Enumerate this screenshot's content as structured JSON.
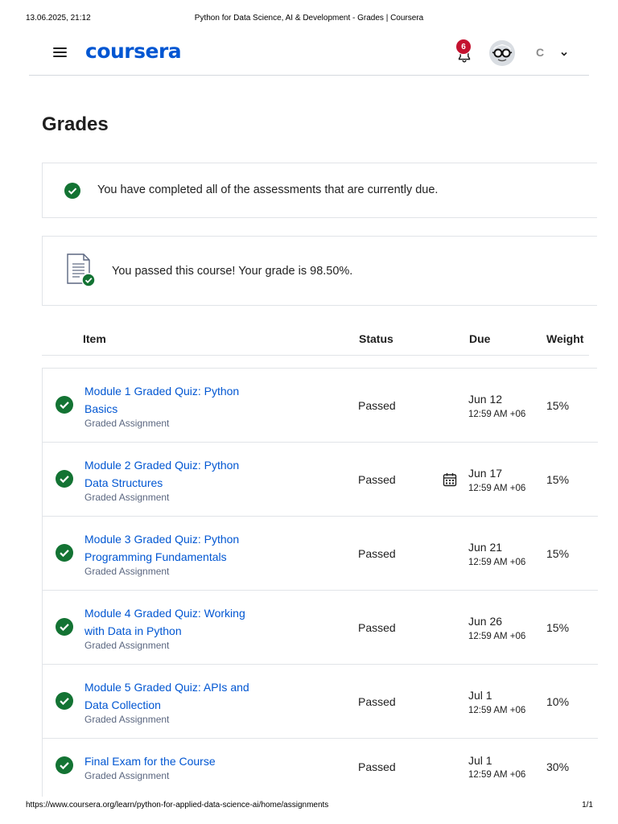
{
  "print": {
    "datetime": "13.06.2025, 21:12",
    "title": "Python for Data Science, AI & Development - Grades | Coursera",
    "url": "https://www.coursera.org/learn/python-for-applied-data-science-ai/home/assignments",
    "page": "1/1"
  },
  "nav": {
    "logo": "coursera",
    "notification_count": "6",
    "user_initial": "C",
    "icons": [
      "menu-icon",
      "bell-icon",
      "avatar",
      "chevron-down-icon"
    ]
  },
  "page_title": "Grades",
  "banners": {
    "completed": "You have completed all of the assessments that are currently due.",
    "passed": "You passed this course! Your grade is 98.50%."
  },
  "table": {
    "headers": {
      "item": "Item",
      "status": "Status",
      "due": "Due",
      "weight": "Weight"
    },
    "rows": [
      {
        "title": "Module 1 Graded Quiz: Python Basics",
        "type": "Graded Assignment",
        "status": "Passed",
        "due_date": "Jun 12",
        "due_time": "12:59 AM +06",
        "weight": "15%"
      },
      {
        "title": "Module 2 Graded Quiz: Python Data Structures",
        "type": "Graded Assignment",
        "status": "Passed",
        "due_date": "Jun 17",
        "due_time": "12:59 AM +06",
        "weight": "15%"
      },
      {
        "title": "Module 3 Graded Quiz: Python Programming Fundamentals",
        "type": "Graded Assignment",
        "status": "Passed",
        "due_date": "Jun 21",
        "due_time": "12:59 AM +06",
        "weight": "15%"
      },
      {
        "title": "Module 4 Graded Quiz: Working with Data in Python",
        "type": "Graded Assignment",
        "status": "Passed",
        "due_date": "Jun 26",
        "due_time": "12:59 AM +06",
        "weight": "15%"
      },
      {
        "title": "Module 5 Graded Quiz: APIs and Data Collection",
        "type": "Graded Assignment",
        "status": "Passed",
        "due_date": "Jul 1",
        "due_time": "12:59 AM +06",
        "weight": "10%"
      },
      {
        "title": "Final Exam for the Course",
        "type": "Graded Assignment",
        "status": "Passed",
        "due_date": "Jul 1",
        "due_time": "12:59 AM +06",
        "weight": "30%"
      }
    ]
  },
  "colors": {
    "brand": "#0056d2",
    "success": "#137333",
    "badge": "#c4122f",
    "text": "#1f1f1f"
  }
}
